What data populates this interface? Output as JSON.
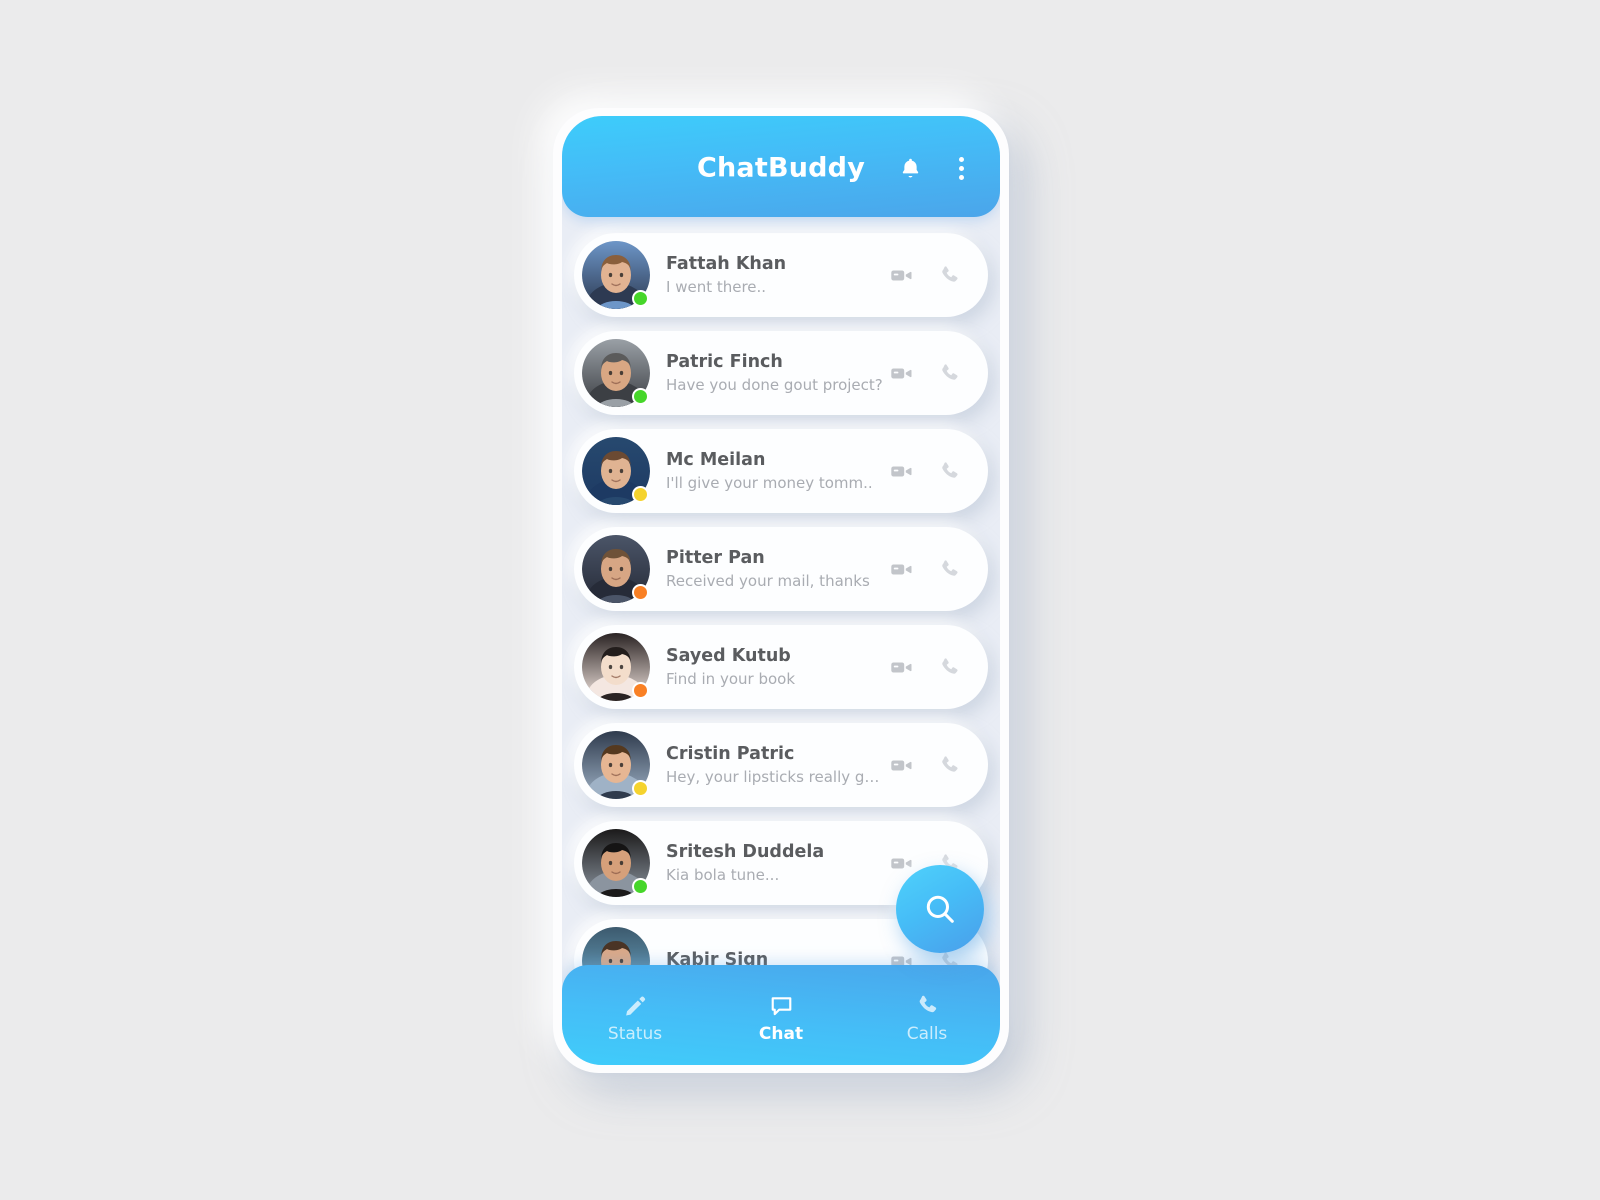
{
  "app": {
    "title": "ChatBuddy",
    "header_icons": [
      "bell-icon",
      "overflow-menu-icon"
    ],
    "colors": {
      "header_gradient_top": "#3dcdfb",
      "header_gradient_bottom": "#4ba5ea",
      "nav_gradient_top": "#4aa6eb",
      "nav_gradient_bottom": "#40ccfa",
      "page_background": "#ebebec",
      "screen_background": "#e9edf5",
      "card_background": "#fdfeff",
      "name_text": "#5a5c5f",
      "message_text": "#a9acb2",
      "status_online": "#46d62a",
      "status_away": "#f5d32e",
      "status_busy": "#f98024"
    }
  },
  "chats": [
    {
      "name": "Fattah Khan",
      "message": "I went there..",
      "status": "online",
      "status_color": "#46d62a",
      "avatar": {
        "skin": "#e2b392",
        "hair": "#8a5f3c",
        "shirt": "#2d3a52",
        "accent": "#6d96c8"
      }
    },
    {
      "name": "Patric Finch",
      "message": "Have you done gout project?",
      "status": "online",
      "status_color": "#46d62a",
      "avatar": {
        "skin": "#d9a783",
        "hair": "#5b5b5b",
        "shirt": "#3c3f44",
        "accent": "#9aa0a6"
      }
    },
    {
      "name": "Mc Meilan",
      "message": "I'll give your money tomm..",
      "status": "away",
      "status_color": "#f5d32e",
      "avatar": {
        "skin": "#e0b392",
        "hair": "#6b4a33",
        "shirt": "#1d3a63",
        "accent": "#27496f"
      }
    },
    {
      "name": "Pitter Pan",
      "message": "Received your mail, thanks",
      "status": "busy",
      "status_color": "#f98024",
      "avatar": {
        "skin": "#d7a684",
        "hair": "#6f5238",
        "shirt": "#262b38",
        "accent": "#4b5568"
      }
    },
    {
      "name": "Sayed Kutub",
      "message": "Find in your book",
      "status": "busy",
      "status_color": "#f98024",
      "avatar": {
        "skin": "#f3ddcb",
        "hair": "#231d1c",
        "shirt": "#f4e7e1",
        "accent": "#2a2323"
      }
    },
    {
      "name": "Cristin Patric",
      "message": "Hey, your lipsticks really good",
      "status": "away",
      "status_color": "#f5d32e",
      "avatar": {
        "skin": "#e6b693",
        "hair": "#55391f",
        "shirt": "#9fb2c6",
        "accent": "#2f3b4d"
      }
    },
    {
      "name": "Sritesh Duddela",
      "message": "Kia bola tune...",
      "status": "online",
      "status_color": "#46d62a",
      "avatar": {
        "skin": "#d6a07a",
        "hair": "#151414",
        "shirt": "#8b949f",
        "accent": "#1b1a1a"
      }
    },
    {
      "name": "Kabir Sign",
      "message": "",
      "status": "online",
      "status_color": "#46d62a",
      "avatar": {
        "skin": "#dba988",
        "hair": "#4a3425",
        "shirt": "#6fa9c6",
        "accent": "#3c5a6e"
      }
    }
  ],
  "row_actions": {
    "video_icon": "video-call-icon",
    "phone_icon": "voice-call-icon"
  },
  "fab": {
    "icon": "search-icon",
    "label": "Search"
  },
  "bottom_nav": {
    "items": [
      {
        "label": "Status",
        "icon": "pencil-icon",
        "active": false
      },
      {
        "label": "Chat",
        "icon": "chat-bubble-icon",
        "active": true
      },
      {
        "label": "Calls",
        "icon": "phone-icon",
        "active": false
      }
    ]
  }
}
